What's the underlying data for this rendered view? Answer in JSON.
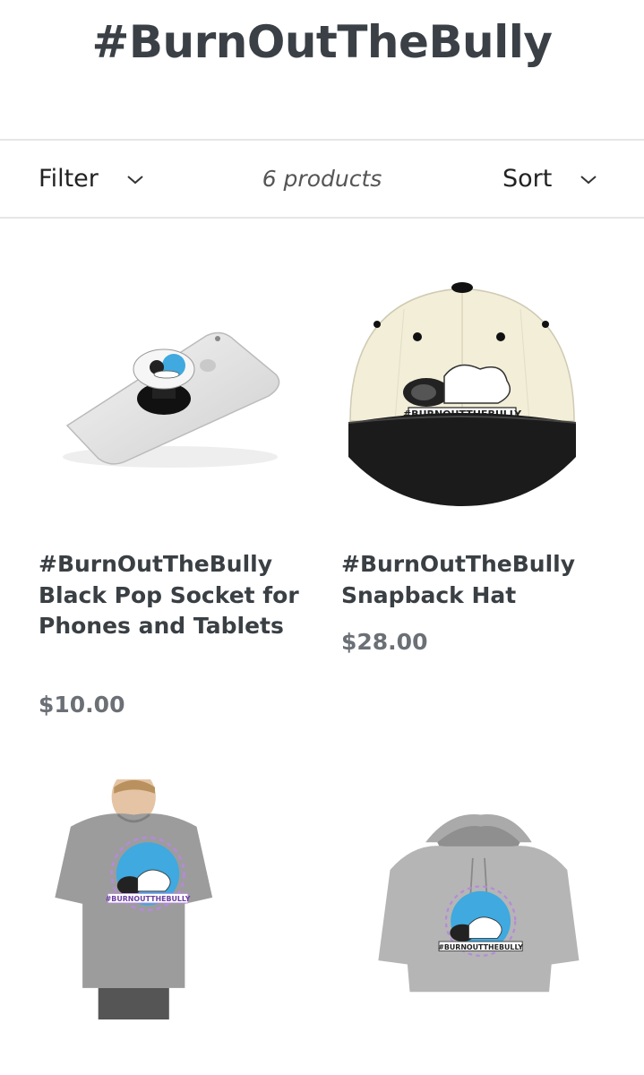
{
  "collection": {
    "title": "#BurnOutTheBully"
  },
  "toolbar": {
    "filter_label": "Filter",
    "product_count": "6 products",
    "sort_label": "Sort"
  },
  "products": [
    {
      "title": "#BurnOutTheBully Black Pop Socket for Phones and Tablets",
      "price": "$10.00",
      "image_icon": "phone-pop-socket-image"
    },
    {
      "title": "#BurnOutTheBully Snapback Hat",
      "price": "$28.00",
      "image_icon": "snapback-hat-image"
    },
    {
      "title": "",
      "price": "",
      "image_icon": "tshirt-image"
    },
    {
      "title": "",
      "price": "",
      "image_icon": "hoodie-image"
    }
  ],
  "colors": {
    "heading": "#3a4046",
    "price": "#6b7076",
    "divider": "#e6e6e6",
    "logo_blue": "#3fa9e0",
    "logo_purple": "#b58ad9"
  }
}
